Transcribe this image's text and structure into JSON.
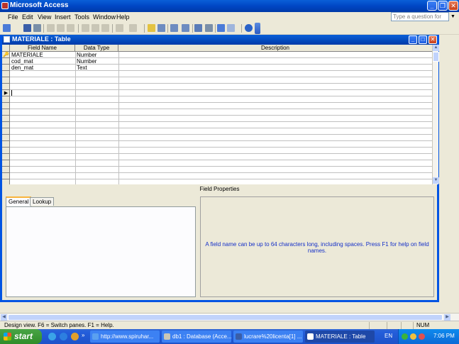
{
  "app": {
    "title": "Microsoft Access",
    "minimize": "_",
    "maximize": "❐",
    "close": "✕"
  },
  "menu": [
    "File",
    "Edit",
    "View",
    "Insert",
    "Tools",
    "Window",
    "Help"
  ],
  "ask_box": {
    "placeholder": "Type a question for help"
  },
  "toolbar": {
    "icons": [
      "view-icon",
      "save-icon",
      "search-icon",
      "print-icon",
      "print-preview-icon",
      "spelling-icon",
      "cut-icon",
      "copy-icon",
      "paste-icon",
      "undo-icon",
      "redo-icon",
      "primary-key-icon",
      "indexes-icon",
      "insert-rows-icon",
      "delete-rows-icon",
      "properties-icon",
      "build-icon",
      "database-window-icon",
      "new-object-icon",
      "help-icon"
    ]
  },
  "child_window": {
    "title": "MATERIALE : Table"
  },
  "grid": {
    "headers": {
      "field_name": "Field Name",
      "data_type": "Data Type",
      "description": "Description"
    },
    "rows": [
      {
        "key": true,
        "field_name": "MATERIALE",
        "data_type": "Number",
        "description": ""
      },
      {
        "key": false,
        "field_name": "cod_mat",
        "data_type": "Number",
        "description": ""
      },
      {
        "key": false,
        "field_name": "den_mat",
        "data_type": "Text",
        "description": ""
      }
    ],
    "current_row_marker": "▶"
  },
  "field_properties": {
    "label": "Field Properties",
    "tabs": [
      "General",
      "Lookup"
    ],
    "help_text": "A field name can be up to 64 characters long, including spaces.  Press F1 for help on field names."
  },
  "statusbar": {
    "text": "Design view.  F6 = Switch panes.  F1 = Help.",
    "num": "NUM"
  },
  "taskbar": {
    "start": "start",
    "tasks": [
      {
        "label": "http://www.spiruhar..."
      },
      {
        "label": "db1 : Database (Acce..."
      },
      {
        "label": "lucrare%20licenta[1] ..."
      },
      {
        "label": "MATERIALE : Table"
      }
    ],
    "language": "EN",
    "clock": "7:06 PM"
  },
  "colors": {
    "title_blue": "#0054e3",
    "help_text": "#1530c8",
    "start_green": "#2f8c29"
  }
}
